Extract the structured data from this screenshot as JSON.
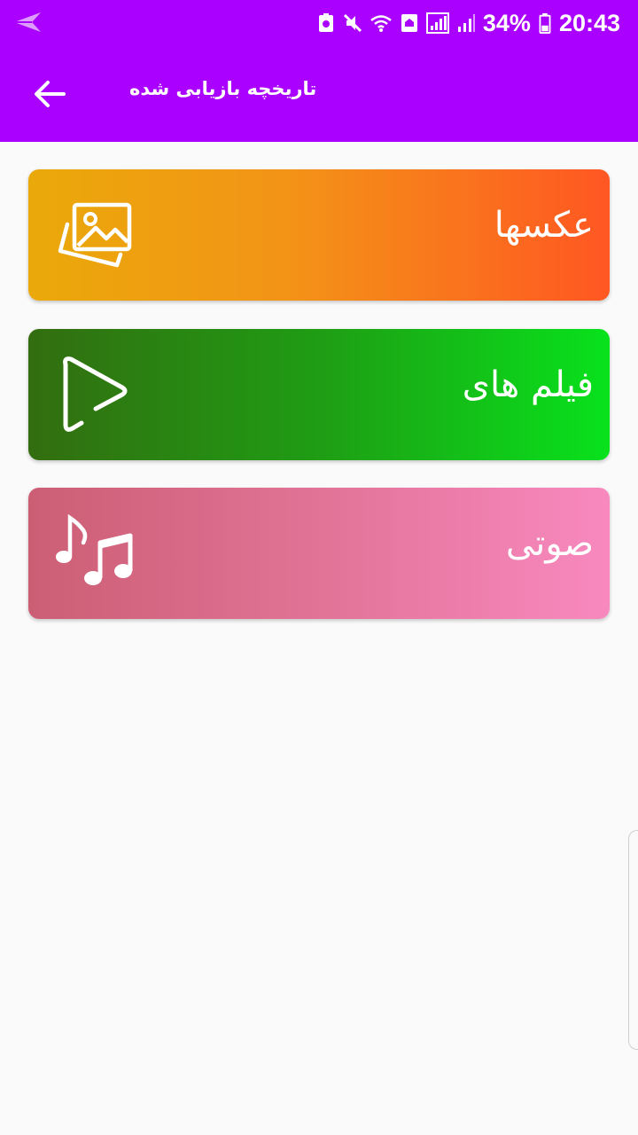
{
  "status_bar": {
    "battery": "34%",
    "time": "20:43",
    "icons": [
      "send-icon",
      "battery-saver-icon",
      "mute-icon",
      "wifi-icon",
      "home-icon",
      "signal-icon",
      "signal-icon",
      "battery-icon"
    ]
  },
  "app_bar": {
    "title": "تاریخچه بازیابی شده",
    "back_icon": "arrow-back-icon",
    "color": "#aa00ff"
  },
  "categories": [
    {
      "label": "عکسها",
      "icon": "image-icon",
      "colors": [
        "#eaa90a",
        "#ff5722"
      ]
    },
    {
      "label": "فیلم های",
      "icon": "play-icon",
      "colors": [
        "#336d10",
        "#08e21c"
      ]
    },
    {
      "label": "صوتی",
      "icon": "music-notes-icon",
      "colors": [
        "#cc5e74",
        "#f889bf"
      ]
    }
  ]
}
